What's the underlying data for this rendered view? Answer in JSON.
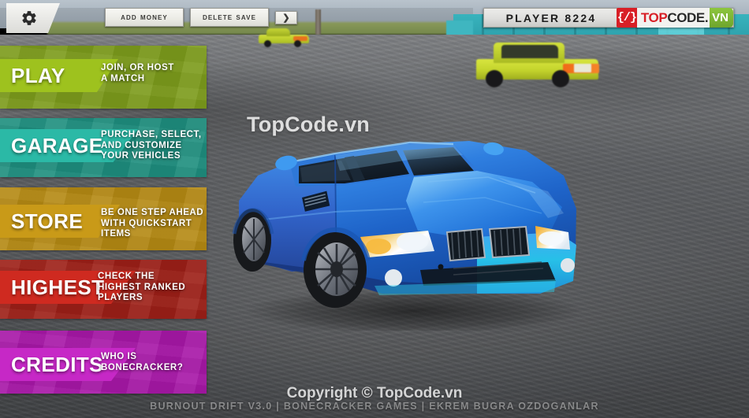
{
  "topbar": {
    "settings_icon": "gear-icon",
    "add_money_label": "Add Money",
    "delete_save_label": "Delete Save",
    "next_label": "❯",
    "player_name": "PLAYER 8224"
  },
  "logo": {
    "shield_glyph": "{/}",
    "word_top": "TOP",
    "word_code": "CODE.",
    "word_vn": "VN",
    "red": "#d81f26",
    "green": "#8dc63f"
  },
  "menu": {
    "items": [
      {
        "id": "play",
        "label": "PLAY",
        "desc": "Join, or host\na match",
        "panel_color": "#7d9c1c",
        "tab_color": "#9ec21e"
      },
      {
        "id": "garage",
        "label": "GARAGE",
        "desc": "Purchase, select,\nand customize\nyour vehicles",
        "panel_color": "#1f8f7f",
        "tab_color": "#2bb9a6"
      },
      {
        "id": "store",
        "label": "STORE",
        "desc": "Be one step ahead\nwith quickstart\nitems",
        "panel_color": "#b58a14",
        "tab_color": "#c99a18"
      },
      {
        "id": "highest",
        "label": "HIGHEST",
        "desc": "Check the\nhighest ranked\nplayers",
        "panel_color": "#9e2018",
        "tab_color": "#cf2a20"
      },
      {
        "id": "credits",
        "label": "CREDITS",
        "desc": "Who is\nbonecracker?",
        "panel_color": "#a818a8",
        "tab_color": "#c628c6"
      }
    ]
  },
  "watermarks": {
    "center": "TopCode.vn",
    "copyright": "Copyright © TopCode.vn"
  },
  "footer": {
    "credit": "BURNOUT DRIFT V3.0 | BONECRACKER GAMES | EKREM BUGRA OZDOGANLAR"
  },
  "scene": {
    "hero_vehicle": "blue-bmw-m3-coupe",
    "parked_vehicle_near": "yellow-sedan",
    "parked_vehicle_far": "yellow-sedan",
    "ground": "asphalt-lot",
    "wall_color": "#2fa3ae"
  }
}
